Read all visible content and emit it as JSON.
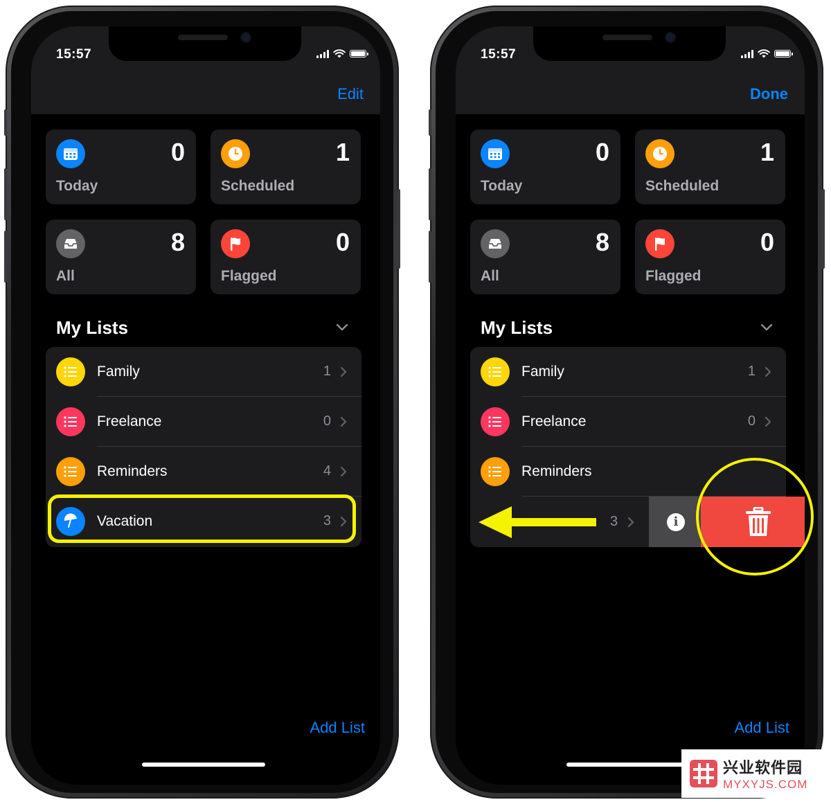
{
  "colors": {
    "accent": "#0a84ff",
    "highlight": "#f5f200",
    "delete": "#f0483e",
    "today": "#0a84ff",
    "scheduled": "#ff9f0a",
    "all": "#636366",
    "flagged": "#ff453a",
    "family": "#ffd60a",
    "freelance": "#ff375f",
    "reminders": "#ff9f0a",
    "vacation": "#0a84ff"
  },
  "left_phone": {
    "status_time": "15:57",
    "nav_action": "Edit",
    "smart_lists": [
      {
        "label": "Today",
        "count": "0",
        "icon": "calendar-icon"
      },
      {
        "label": "Scheduled",
        "count": "1",
        "icon": "clock-icon"
      },
      {
        "label": "All",
        "count": "8",
        "icon": "tray-icon"
      },
      {
        "label": "Flagged",
        "count": "0",
        "icon": "flag-icon"
      }
    ],
    "section_title": "My Lists",
    "lists": [
      {
        "name": "Family",
        "count": "1",
        "icon": "list-icon"
      },
      {
        "name": "Freelance",
        "count": "0",
        "icon": "list-icon"
      },
      {
        "name": "Reminders",
        "count": "4",
        "icon": "list-icon"
      },
      {
        "name": "Vacation",
        "count": "3",
        "icon": "umbrella-icon"
      }
    ],
    "add_list": "Add List"
  },
  "right_phone": {
    "status_time": "15:57",
    "nav_action": "Done",
    "smart_lists": [
      {
        "label": "Today",
        "count": "0",
        "icon": "calendar-icon"
      },
      {
        "label": "Scheduled",
        "count": "1",
        "icon": "clock-icon"
      },
      {
        "label": "All",
        "count": "8",
        "icon": "tray-icon"
      },
      {
        "label": "Flagged",
        "count": "0",
        "icon": "flag-icon"
      }
    ],
    "section_title": "My Lists",
    "lists": [
      {
        "name": "Family",
        "count": "1",
        "icon": "list-icon"
      },
      {
        "name": "Freelance",
        "count": "0",
        "icon": "list-icon"
      },
      {
        "name": "Reminders",
        "count": "",
        "icon": "list-icon"
      }
    ],
    "swiped_row": {
      "count": "3",
      "info_glyph": "i",
      "delete_icon": "trash-icon"
    },
    "add_list": "Add List"
  },
  "watermark": {
    "cn": "兴业软件园",
    "en": "MYXYJS.COM"
  }
}
